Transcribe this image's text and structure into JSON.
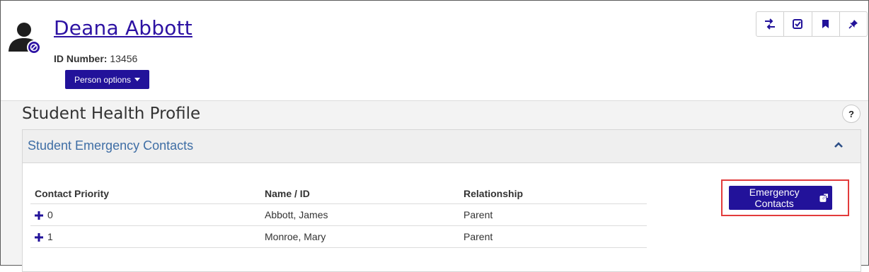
{
  "person": {
    "name": "Deana Abbott",
    "id_label": "ID Number:",
    "id_value": "13456",
    "options_label": "Person options"
  },
  "toolbar": {
    "icons": [
      "swap-icon",
      "checkmark-icon",
      "bookmark-icon",
      "pin-icon"
    ]
  },
  "page": {
    "title": "Student Health Profile",
    "help_label": "?"
  },
  "panel": {
    "title": "Student Emergency Contacts",
    "columns": [
      "Contact Priority",
      "Name / ID",
      "Relationship"
    ],
    "rows": [
      {
        "priority": "0",
        "name": "Abbott, James",
        "relationship": "Parent"
      },
      {
        "priority": "1",
        "name": "Monroe, Mary",
        "relationship": "Parent"
      }
    ],
    "button_label": "Emergency Contacts"
  },
  "colors": {
    "brand": "#22129a",
    "link": "#2d12a3",
    "panel_title": "#3f6ea5",
    "highlight": "#e23b3b"
  }
}
